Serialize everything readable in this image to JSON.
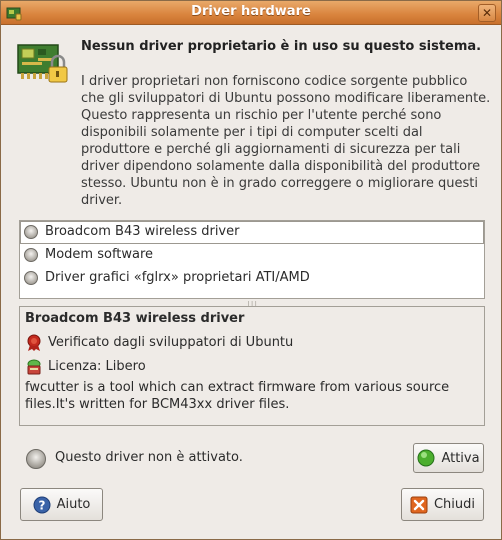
{
  "window": {
    "title": "Driver hardware"
  },
  "header": {
    "title": "Nessun driver proprietario è in uso su questo sistema.",
    "description": "I driver proprietari non forniscono codice sorgente pubblico che gli sviluppatori di Ubuntu possono modificare liberamente. Questo rappresenta un rischio per l'utente perché sono disponibili solamente per i tipi di computer scelti dal produttore e perché gli aggiornamenti di sicurezza per tali driver dipendono solamente dalla disponibilità del produttore stesso. Ubuntu non è in grado correggere o migliorare questi driver."
  },
  "drivers": [
    {
      "label": "Broadcom B43 wireless driver",
      "selected": true
    },
    {
      "label": "Modem software",
      "selected": false
    },
    {
      "label": "Driver grafici «fglrx» proprietari ATI/AMD",
      "selected": false
    }
  ],
  "detail": {
    "title": "Broadcom B43 wireless driver",
    "verified": "Verificato dagli sviluppatori di Ubuntu",
    "license": "Licenza: Libero",
    "description": "fwcutter is a tool which can extract firmware from various source files.It's written for BCM43xx driver files."
  },
  "status": {
    "text": "Questo driver non è attivato."
  },
  "buttons": {
    "activate": "Attiva",
    "help": "Aiuto",
    "close": "Chiudi"
  },
  "colors": {
    "titlebar": "#d9833d",
    "activate_icon": "#4cae2e",
    "close_icon": "#e0661f",
    "help_icon": "#3a63a8"
  }
}
